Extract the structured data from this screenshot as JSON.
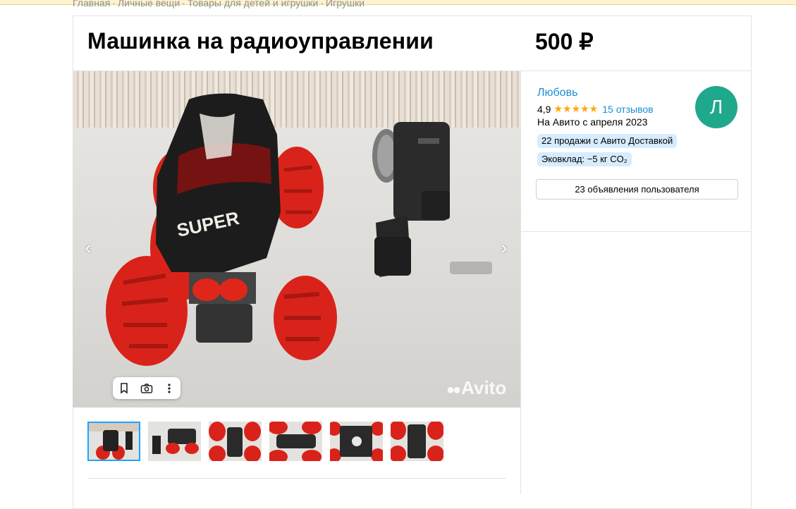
{
  "breadcrumbs": [
    "Главная",
    "Личные вещи",
    "Товары для детей и игрушки",
    "Игрушки"
  ],
  "breadcrumb_separator": "·",
  "listing": {
    "title": "Машинка на радиоуправлении",
    "price": "500 ₽"
  },
  "gallery": {
    "prev_arrow": "‹",
    "next_arrow": "›",
    "watermark": "Avito",
    "watermark_dots": "●●",
    "tools": [
      "bookmark-icon",
      "camera-icon",
      "more-icon"
    ],
    "thumbnail_count": 6,
    "active_thumbnail": 1
  },
  "seller": {
    "name": "Любовь",
    "rating": "4,9",
    "stars": "★★★★★",
    "reviews": "15 отзывов",
    "since": "На Авито с апреля 2023",
    "badges": [
      "22 продажи с Авито Доставкой",
      "Эковклад: −5 кг CO₂"
    ],
    "avatar_letter": "Л",
    "avatar_color": "#1fa88c",
    "ads_button": "23 объявления пользователя"
  },
  "colors": {
    "link": "#1a8fd6",
    "star": "#ffa800",
    "chip_bg": "#d6ecff",
    "active_thumb_border": "#1aa3ff"
  }
}
